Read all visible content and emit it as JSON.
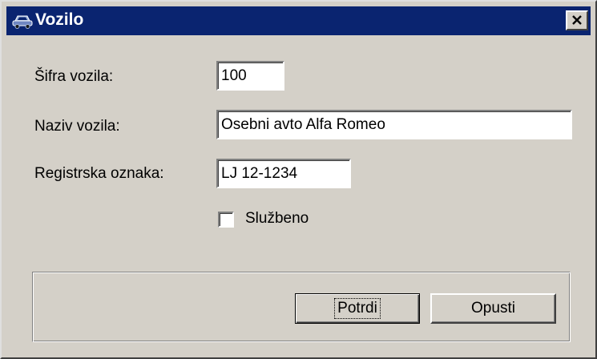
{
  "window": {
    "title": "Vozilo",
    "icon": "car-icon",
    "close_icon": "close-icon"
  },
  "form": {
    "code_label": "Šifra vozila:",
    "code_value": "100",
    "name_label": "Naziv vozila:",
    "name_value": "Osebni avto Alfa Romeo",
    "registration_label": "Registrska oznaka:",
    "registration_value": "LJ 12-1234",
    "business_label": "Službeno",
    "business_checked": false
  },
  "buttons": {
    "confirm_label": "Potrdi",
    "cancel_label": "Opusti"
  },
  "colors": {
    "titlebar": "#0a2470",
    "face": "#d4d0c8"
  }
}
